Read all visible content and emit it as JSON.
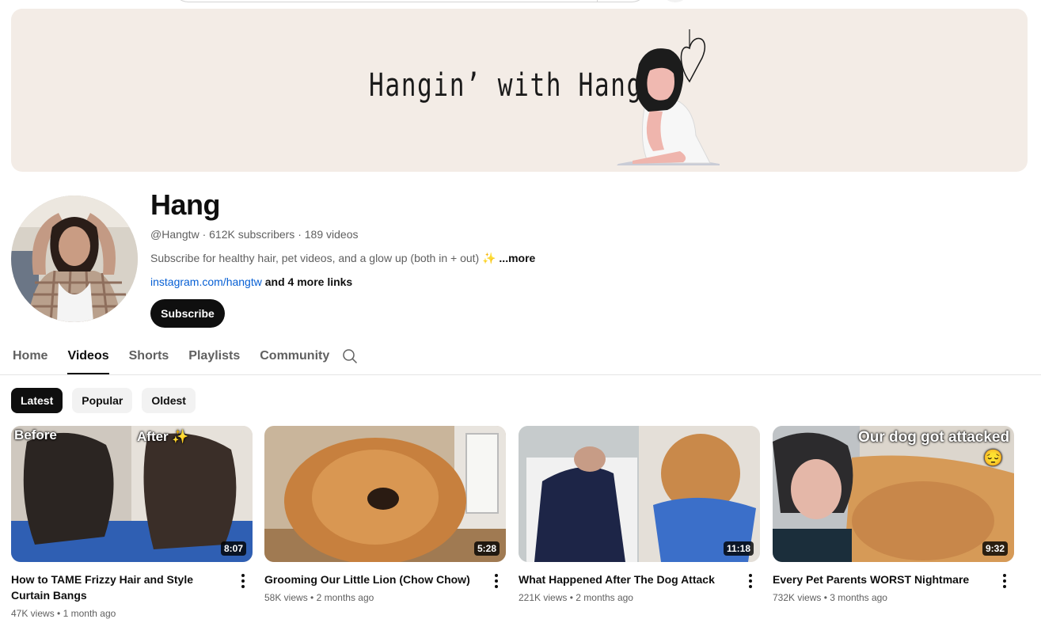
{
  "banner": {
    "title": "Hangin’ with Hang"
  },
  "channel": {
    "name": "Hang",
    "handle": "@Hangtw",
    "subscribers": "612K subscribers",
    "video_count": "189 videos",
    "description": "Subscribe for healthy hair, pet videos, and a glow up (both in + out) ✨",
    "description_more": "...more",
    "link": "instagram.com/hangtw",
    "more_links": "and 4 more links",
    "subscribe_label": "Subscribe"
  },
  "tabs": [
    {
      "label": "Home",
      "active": false
    },
    {
      "label": "Videos",
      "active": true
    },
    {
      "label": "Shorts",
      "active": false
    },
    {
      "label": "Playlists",
      "active": false
    },
    {
      "label": "Community",
      "active": false
    }
  ],
  "chips": [
    {
      "label": "Latest",
      "active": true
    },
    {
      "label": "Popular",
      "active": false
    },
    {
      "label": "Oldest",
      "active": false
    }
  ],
  "videos": [
    {
      "title": "How to TAME Frizzy Hair and Style Curtain Bangs",
      "views": "47K views",
      "age": "1 month ago",
      "duration": "8:07",
      "caption_left": "Before",
      "caption_right": "After ✨"
    },
    {
      "title": "Grooming Our Little Lion (Chow Chow)",
      "views": "58K views",
      "age": "2 months ago",
      "duration": "5:28"
    },
    {
      "title": "What Happened After The Dog Attack",
      "views": "221K views",
      "age": "2 months ago",
      "duration": "11:18"
    },
    {
      "title": "Every Pet Parents WORST Nightmare",
      "views": "732K views",
      "age": "3 months ago",
      "duration": "9:32",
      "caption": "Our dog got attacked",
      "caption_emoji": "😔"
    }
  ],
  "separator": "•",
  "meta_separator": "·",
  "colors": {
    "banner_bg": "#f3ece6",
    "link": "#065fd4",
    "primary": "#0f0f0f",
    "secondary": "#606060"
  }
}
